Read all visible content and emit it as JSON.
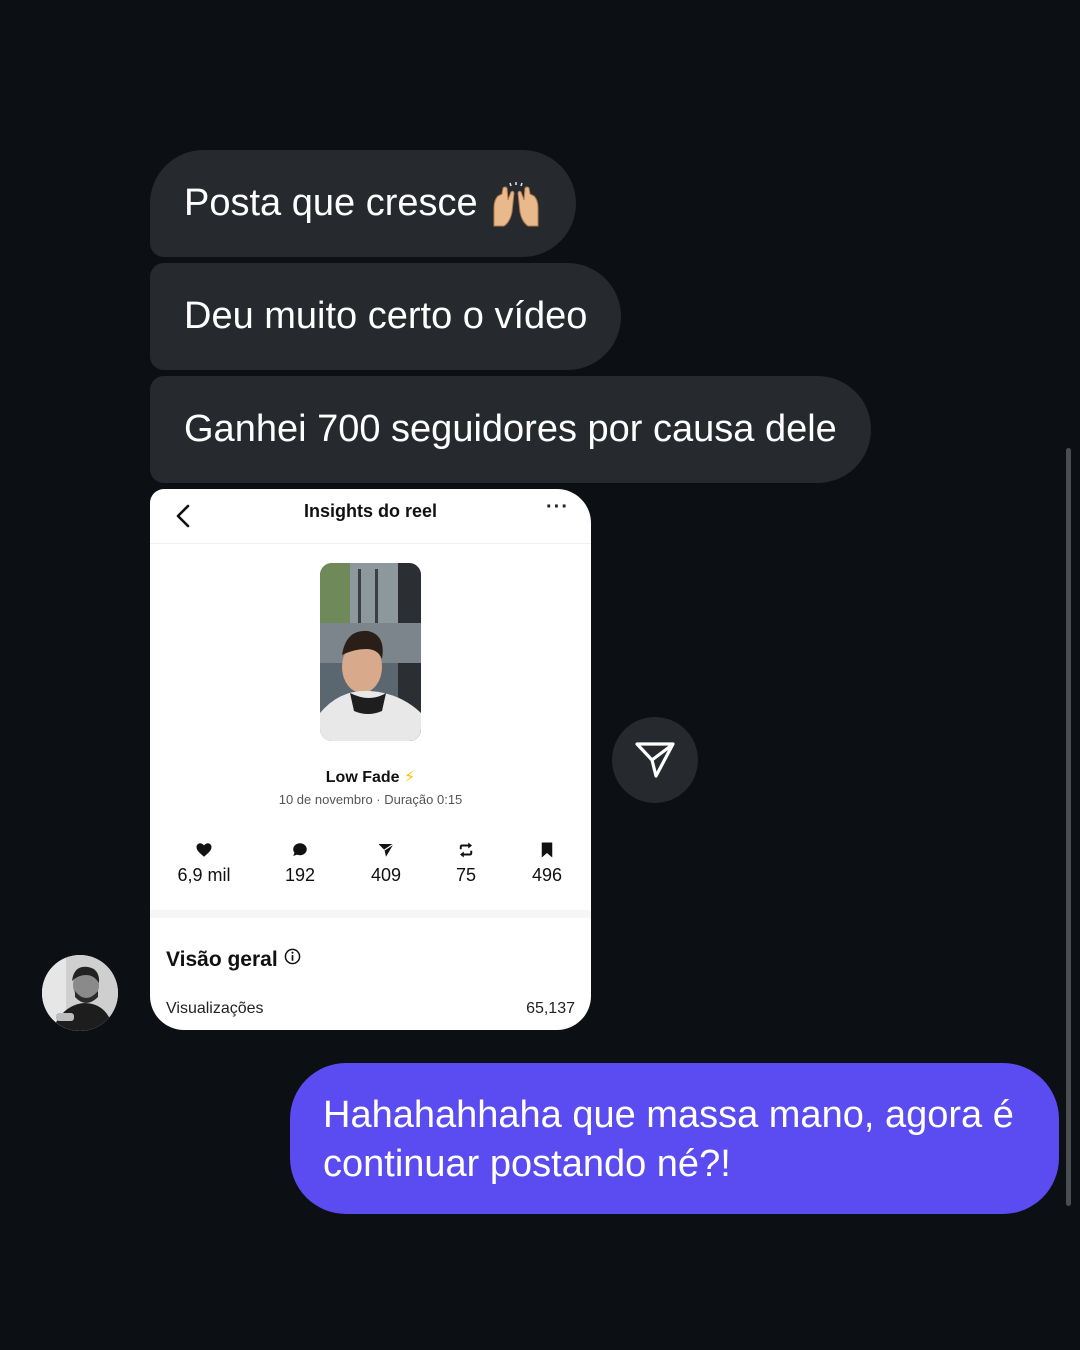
{
  "messages_in": [
    {
      "text": "Posta que cresce",
      "emoji": "raising-hands-emoji"
    },
    {
      "text": "Deu muito certo o vídeo"
    },
    {
      "text": "Ganhei 700 seguidores por causa dele"
    }
  ],
  "shared_card": {
    "header_title": "Insights do reel",
    "back_icon": "chevron-left-icon",
    "more_icon": "more-horizontal-icon",
    "reel_title": "Low Fade",
    "reel_title_emoji": "⚡",
    "reel_meta": "10 de novembro · Duração 0:15",
    "stats": [
      {
        "icon": "heart-icon",
        "value": "6,9 mil"
      },
      {
        "icon": "comment-icon",
        "value": "192"
      },
      {
        "icon": "send-icon",
        "value": "409"
      },
      {
        "icon": "repost-icon",
        "value": "75"
      },
      {
        "icon": "bookmark-icon",
        "value": "496"
      }
    ],
    "overview_title": "Visão geral",
    "views_label": "Visualizações",
    "views_value": "65,137"
  },
  "share_button_icon": "send-icon",
  "message_out": {
    "text": "Hahahahhaha que massa mano, agora é continuar postando né?!"
  },
  "colors": {
    "background": "#0c1014",
    "incoming_bubble": "#26292e",
    "outgoing_bubble": "#5a4cf0"
  }
}
